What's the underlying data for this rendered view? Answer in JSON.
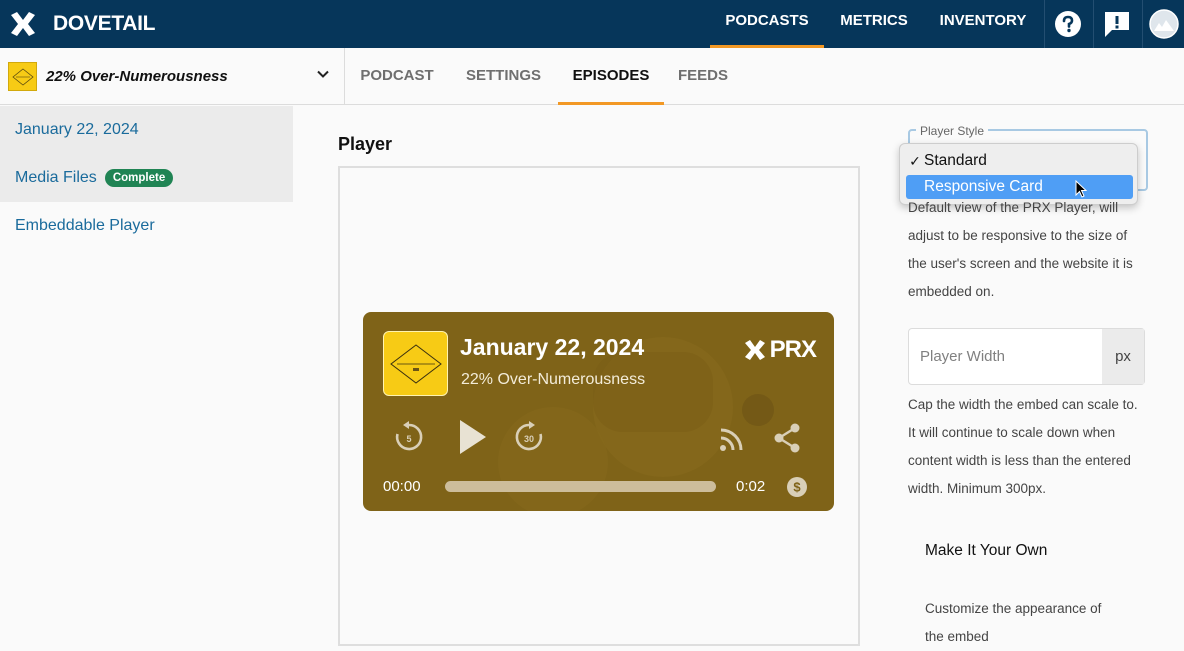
{
  "brand": {
    "name": "DOVETAIL"
  },
  "nav": {
    "items": [
      "PODCASTS",
      "METRICS",
      "INVENTORY"
    ],
    "active": "PODCASTS"
  },
  "nav_icons": [
    "help-icon",
    "feedback-icon",
    "user-avatar"
  ],
  "podcast": {
    "name": "22% Over-Numerousness"
  },
  "tabs": [
    "PODCAST",
    "SETTINGS",
    "EPISODES",
    "FEEDS"
  ],
  "active_tab": "EPISODES",
  "sidebar": {
    "items": [
      {
        "label": "January 22, 2024"
      },
      {
        "label": "Media Files",
        "badge": "Complete"
      },
      {
        "label": "Embeddable Player"
      }
    ]
  },
  "main": {
    "section_title": "Player"
  },
  "player": {
    "title": "January 22, 2024",
    "subtitle": "22% Over-Numerousness",
    "logo": "PRX",
    "time_current": "00:00",
    "time_total": "0:02",
    "progress": 0.0,
    "skip_back": "5",
    "skip_forward": "30"
  },
  "player_style": {
    "legend": "Player Style",
    "options": [
      "Standard",
      "Responsive Card"
    ],
    "checked": "Standard",
    "highlighted": "Responsive Card",
    "checkmark": "✓"
  },
  "help": {
    "style": [
      "Default view of the PRX Player, will",
      "adjust to be responsive to the size of",
      "the user's screen and the website it is",
      "embedded on."
    ],
    "width": [
      "Cap the width the embed can scale to.",
      "It will continue to scale down when",
      "content width is less than the entered",
      "width. Minimum 300px."
    ]
  },
  "width_field": {
    "placeholder": "Player Width",
    "value": "",
    "addon": "px"
  },
  "make_own": {
    "title": "Make It Your Own",
    "text": [
      "Customize the appearance of",
      "the embed"
    ]
  },
  "colors": {
    "navbar": "#06365a",
    "accent": "#f29824",
    "link": "#1a6b9c",
    "badge": "#208454",
    "player_bg": "#7f6318"
  }
}
